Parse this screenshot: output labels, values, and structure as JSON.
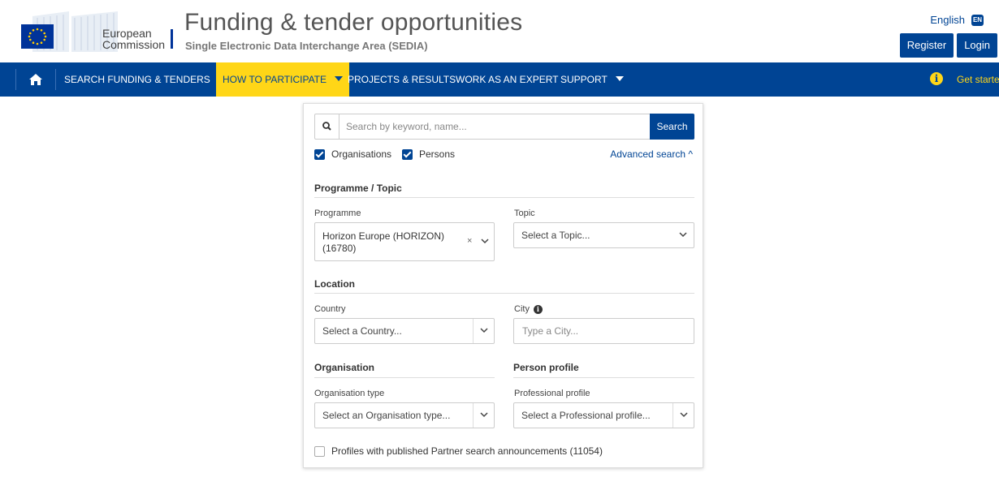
{
  "header": {
    "logo_line1": "European",
    "logo_line2": "Commission",
    "title": "Funding & tender opportunities",
    "subtitle": "Single Electronic Data Interchange Area (SEDIA)",
    "language": "English",
    "language_code": "EN",
    "register_label": "Register",
    "login_label": "Login"
  },
  "nav": {
    "home_icon": "home-icon",
    "items": [
      {
        "label": "SEARCH FUNDING & TENDERS",
        "dropdown": true
      },
      {
        "label": "HOW TO PARTICIPATE",
        "dropdown": true,
        "active": true
      },
      {
        "label": "PROJECTS & RESULTS",
        "dropdown": false
      },
      {
        "label": "WORK AS AN EXPERT",
        "dropdown": false
      },
      {
        "label": "SUPPORT",
        "dropdown": true
      }
    ],
    "get_started": "Get started",
    "accent_color": "#ffd617",
    "brand_color": "#004494"
  },
  "search": {
    "placeholder": "Search by keyword, name...",
    "button_label": "Search",
    "filter_organisations": "Organisations",
    "filter_persons": "Persons",
    "advanced_label": "Advanced search ^"
  },
  "programme_topic": {
    "heading": "Programme / Topic",
    "programme_label": "Programme",
    "programme_value": "Horizon Europe (HORIZON) (16780)",
    "clear_symbol": "×",
    "topic_label": "Topic",
    "topic_placeholder": "Select a Topic..."
  },
  "location": {
    "heading": "Location",
    "country_label": "Country",
    "country_placeholder": "Select a Country...",
    "city_label": "City",
    "city_placeholder": "Type a City..."
  },
  "organisation": {
    "heading": "Organisation",
    "type_label": "Organisation type",
    "type_placeholder": "Select an Organisation type..."
  },
  "person": {
    "heading": "Person profile",
    "profile_label": "Professional profile",
    "profile_placeholder": "Select a Professional profile..."
  },
  "partner_filter": {
    "label": "Profiles with published Partner search announcements (11054)",
    "checked": false
  }
}
